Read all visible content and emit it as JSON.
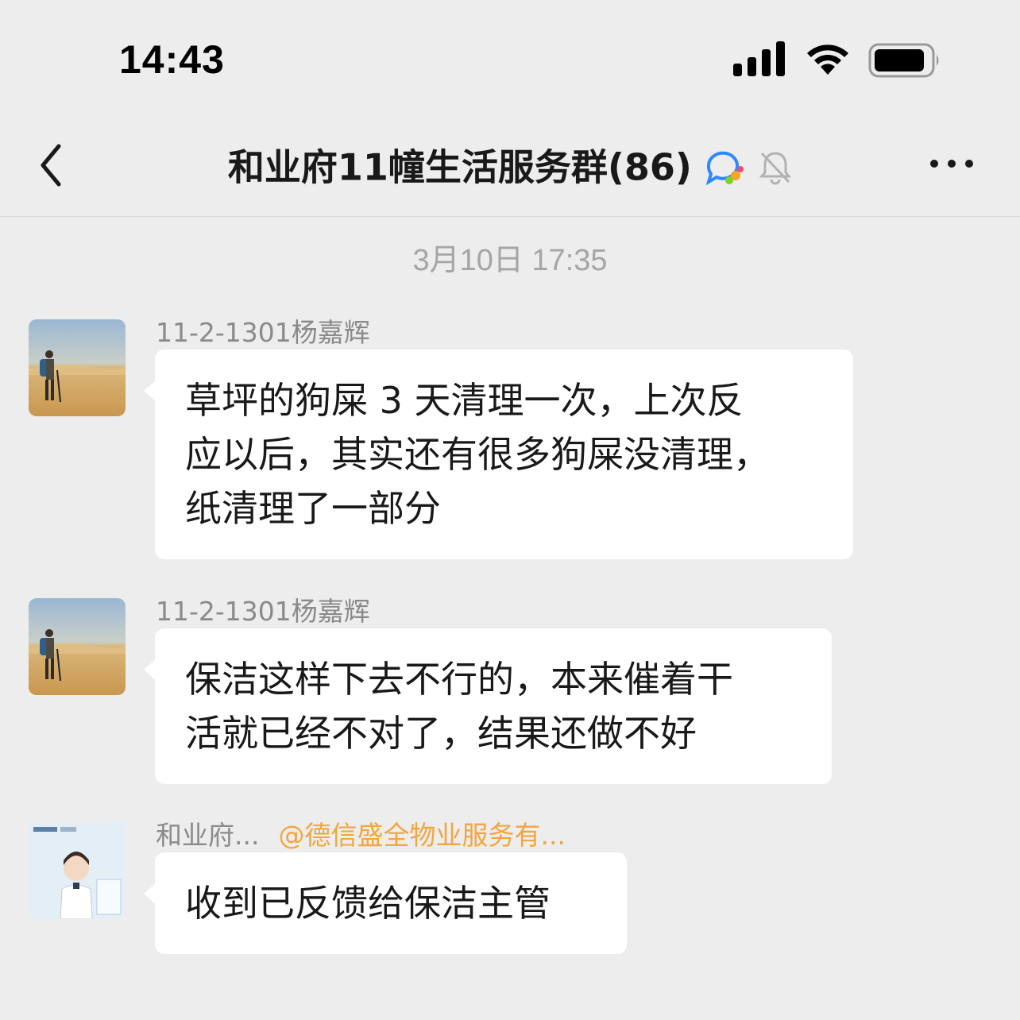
{
  "status_bar": {
    "time": "14:43",
    "icons": [
      "signal-icon",
      "wifi-icon",
      "battery-icon"
    ]
  },
  "nav": {
    "back_icon": "chevron-left-icon",
    "title": "和业府11幢生活服务群(86)",
    "title_badge_icon": "chat-bubble-icon",
    "mute_icon": "bell-muted-icon",
    "more_icon": "more-dots-icon"
  },
  "divider": {
    "top": "3月10日 17:35"
  },
  "messages": [
    {
      "sender": "11-2-1301杨嘉辉",
      "avatar": "desert-hiker-avatar",
      "lines": [
        "草坪的狗屎 3 天清理一次，上次反",
        "应以后，其实还有很多狗屎没清理，",
        "纸清理了一部分"
      ]
    },
    {
      "sender": "11-2-1301杨嘉辉",
      "avatar": "desert-hiker-avatar",
      "lines": [
        "保洁这样下去不行的，本来催着干",
        "活就已经不对了，结果还做不好"
      ]
    },
    {
      "sender": "和业府...",
      "mention": "@德信盛全物业服务有...",
      "avatar": "property-service-avatar",
      "lines": [
        "收到已反馈给保洁主管"
      ]
    }
  ],
  "colors": {
    "background": "#ededed",
    "bubble": "#ffffff",
    "mention": "#f4a53c",
    "sender": "#8a8a8a"
  }
}
